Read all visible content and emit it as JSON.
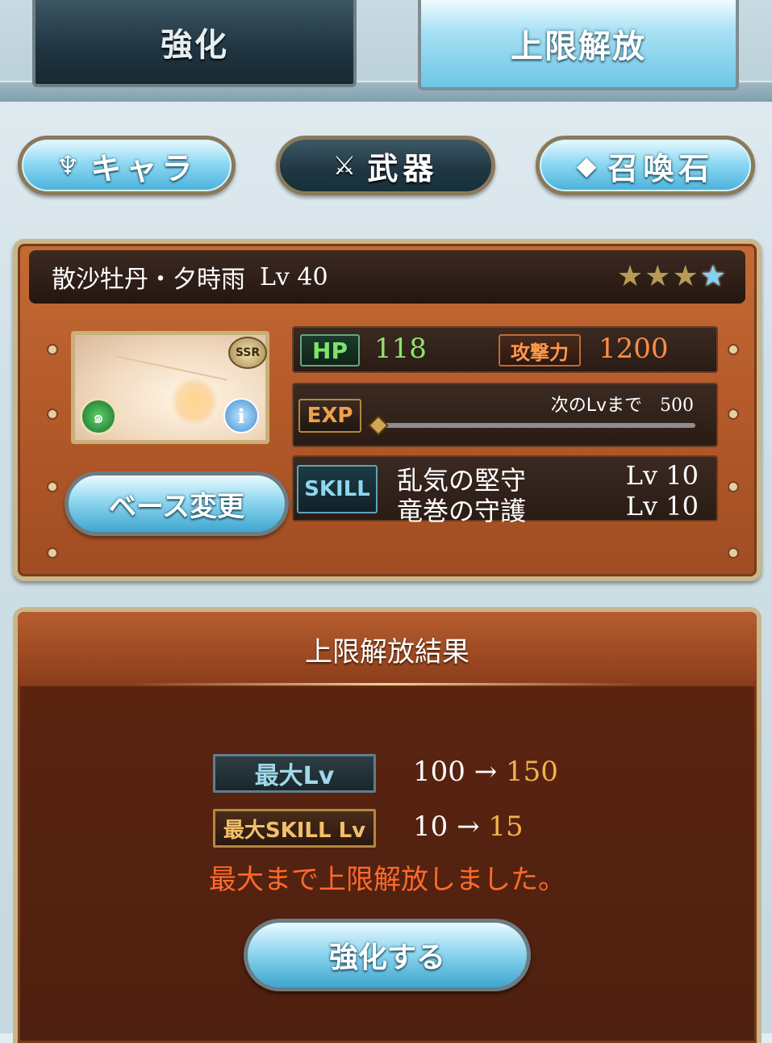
{
  "tabs": {
    "enhance": "強化",
    "uncap": "上限解放"
  },
  "categories": {
    "character": "キャラ",
    "weapon": "武器",
    "summon": "召喚石"
  },
  "weapon": {
    "name": "散沙牡丹・夕時雨",
    "level": "Lv 40",
    "rarity_badge": "SSR",
    "uncap_stars": {
      "filled": 3,
      "blue": 1
    },
    "hp_label": "HP",
    "hp": "118",
    "atk_label": "攻撃力",
    "atk": "1200",
    "exp_label": "EXP",
    "next_lv_label": "次のLvまで",
    "next_lv_value": "500",
    "exp_progress": 0,
    "skill_label": "SKILL",
    "skills": [
      {
        "name": "乱気の堅守",
        "level": "Lv 10"
      },
      {
        "name": "竜巻の守護",
        "level": "Lv 10"
      }
    ],
    "base_change": "ベース変更"
  },
  "result": {
    "title": "上限解放結果",
    "max_lv_label": "最大Lv",
    "max_lv_from": "100",
    "max_lv_to": "150",
    "max_skill_label": "最大SKILL Lv",
    "max_skill_from": "10",
    "max_skill_to": "15",
    "arrow": "→",
    "message": "最大まで上限解放しました。",
    "enhance_button": "強化する"
  },
  "colors": {
    "panel_orange": "#b45a2a",
    "hp_green": "#8fe36d",
    "atk_orange": "#ff8d45",
    "message_red": "#ff6a2c",
    "accent_gold": "#f2b24a"
  },
  "icons": {
    "character": "character-emblem-icon",
    "weapon": "crossed-swords-icon",
    "summon": "crystal-icon",
    "element": "wind-element-icon",
    "info": "info-icon"
  }
}
